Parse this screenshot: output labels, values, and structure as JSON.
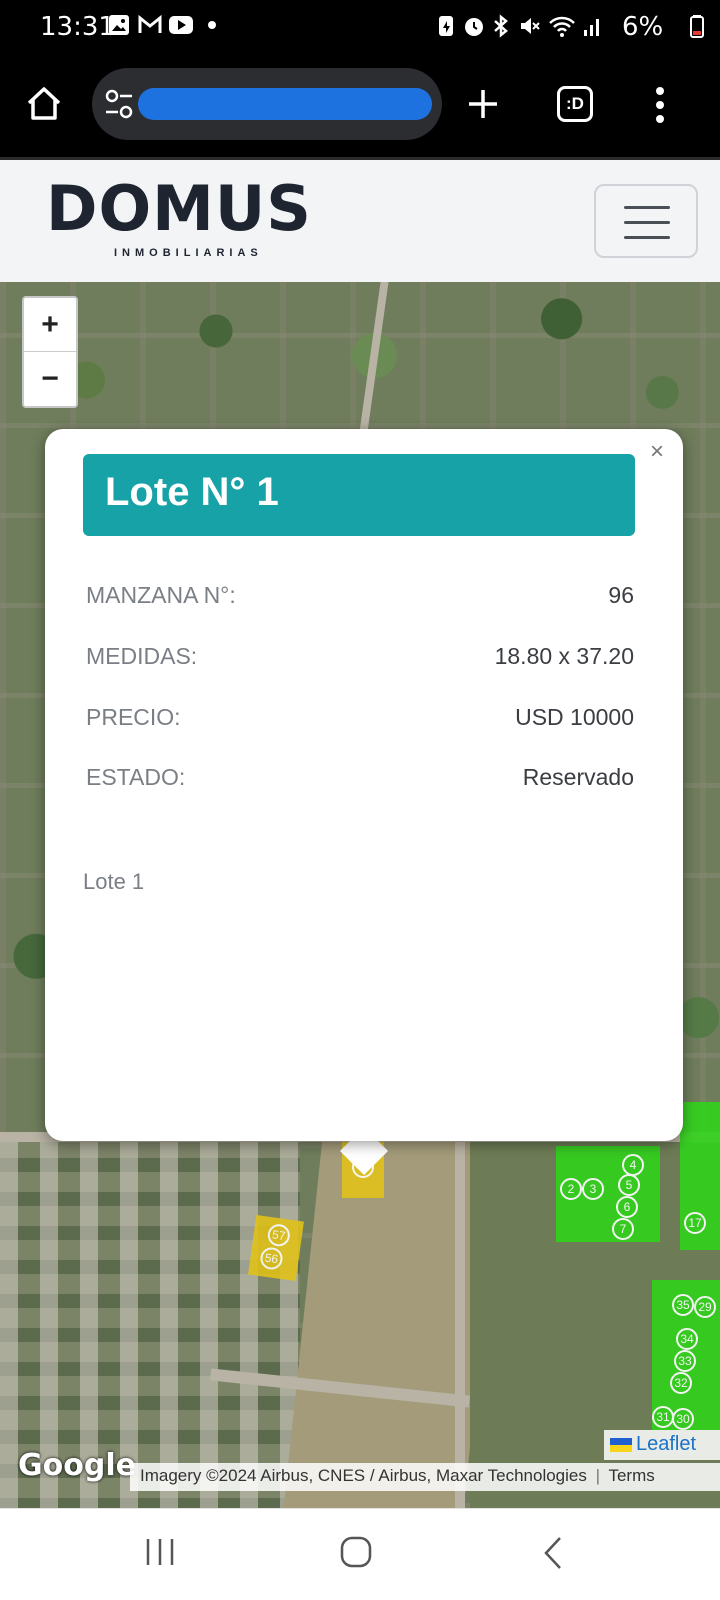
{
  "status_bar": {
    "time": "13:31",
    "battery": "6%",
    "left_icons": [
      "gallery-icon",
      "gmail-icon",
      "youtube-icon",
      "dot-icon"
    ],
    "right_icons": [
      "data-saver-icon",
      "alarm-icon",
      "bluetooth-icon",
      "mute-icon",
      "wifi-icon",
      "signal-icon",
      "battery-icon"
    ]
  },
  "browser": {
    "url_redacted": true,
    "actions": [
      "home-icon",
      "site-info-icon",
      "new-tab-icon",
      "tab-switcher-icon",
      "more-menu-icon"
    ],
    "tab_switcher_label": ":D"
  },
  "site": {
    "logo_main": "DOMUS",
    "logo_sub": "INMOBILIARIAS"
  },
  "map": {
    "zoom_in": "+",
    "zoom_out": "−",
    "google_logo": "Google",
    "leaflet_label": "Leaflet",
    "imagery_attribution": "Imagery ©2024 Airbus, CNES / Airbus, Maxar Technologies",
    "terms": "Terms",
    "lots_yellow": [
      "1",
      "57",
      "56"
    ],
    "lots_green_a": [
      "4",
      "2",
      "3",
      "5",
      "6",
      "7"
    ],
    "lots_green_b": [
      "17"
    ],
    "lots_green_c": [
      "35",
      "29",
      "34",
      "33",
      "32",
      "31",
      "30"
    ],
    "colors": {
      "reserved": "#e0c21a",
      "available": "#32d11d",
      "popup_title": "#16a2a6"
    }
  },
  "popup": {
    "title": "Lote N° 1",
    "close": "×",
    "rows": [
      {
        "label": "MANZANA N°:",
        "value": "96"
      },
      {
        "label": "MEDIDAS:",
        "value": "18.80 x 37.20"
      },
      {
        "label": "PRECIO:",
        "value": "USD 10000"
      },
      {
        "label": "ESTADO:",
        "value": "Reservado"
      }
    ],
    "description": "Lote 1"
  },
  "nav": [
    "recents-icon",
    "home-button-icon",
    "back-icon"
  ]
}
